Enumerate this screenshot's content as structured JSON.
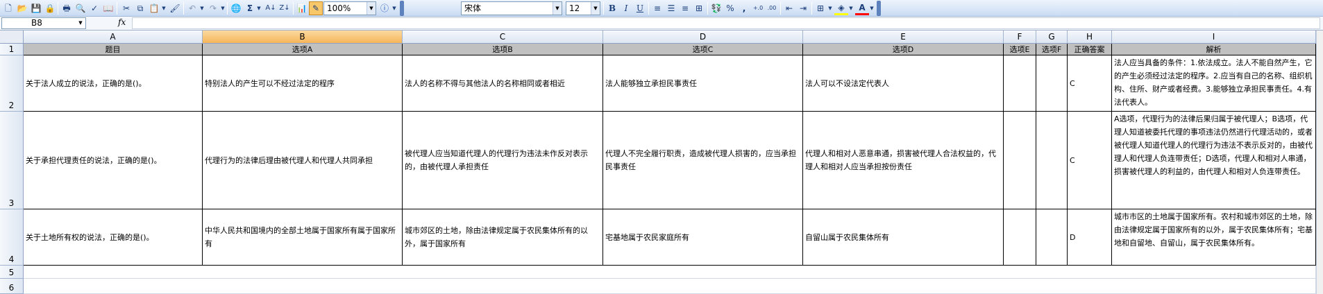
{
  "toolbar": {
    "zoom": "100%",
    "font_name": "宋体",
    "font_size": "12",
    "bold": "B",
    "italic": "I",
    "underline": "U",
    "currency": "%",
    "comma": ",",
    "icons": [
      "new-icon",
      "open-icon",
      "save-icon",
      "permission-icon",
      "email-icon",
      "print-icon",
      "print-preview-icon",
      "spelling-icon",
      "research-icon",
      "cut-icon",
      "copy-icon",
      "paste-icon",
      "format-painter-icon",
      "undo-icon",
      "redo-icon",
      "hyperlink-icon",
      "autosum-icon",
      "sort-ascending-icon",
      "sort-descending-icon",
      "chart-wizard-icon",
      "drawing-icon",
      "help-icon"
    ]
  },
  "formula_bar": {
    "name_box": "B8",
    "fx": "fx",
    "formula": ""
  },
  "columns": [
    "A",
    "B",
    "C",
    "D",
    "E",
    "F",
    "G",
    "H",
    "I"
  ],
  "selected_column": "B",
  "rows": [
    "1",
    "2",
    "3",
    "4",
    "5",
    "6"
  ],
  "header_row": [
    "题目",
    "选项A",
    "选项B",
    "选项C",
    "选项D",
    "选项E",
    "选项F",
    "正确答案",
    "解析"
  ],
  "data_rows": [
    [
      "关于法人成立的说法，正确的是()。",
      "特别法人的产生可以不经过法定的程序",
      "法人的名称不得与其他法人的名称相同或者相近",
      "法人能够独立承担民事责任",
      "法人可以不设法定代表人",
      "",
      "",
      "C",
      "法人应当具备的条件：1.依法成立。法人不能自然产生，它的产生必须经过法定的程序。2.应当有自己的名称、组织机构、住所、财产或者经费。3.能够独立承担民事责任。4.有法代表人。"
    ],
    [
      "关于承担代理责任的说法，正确的是()。",
      "代理行为的法律后理由被代理人和代理人共同承担",
      "被代理人应当知道代理人的代理行为违法未作反对表示的，由被代理人承担责任",
      "代理人不完全履行职责，造成被代理人损害的，应当承担民事责任",
      "代理人和相对人恶意串通，损害被代理人合法权益的，代理人和相对人应当承担按份责任",
      "",
      "",
      "C",
      "A选项，代理行为的法律后果归属于被代理人；B选项，代理人知道被委托代理的事项违法仍然进行代理活动的，或者被代理人知道代理人的代理行为违法不表示反对的，由被代理人和代理人负连带责任；D选项，代理人和相对人串通，损害被代理人的利益的，由代理人和相对人负连带责任。"
    ],
    [
      "关于土地所有权的说法，正确的是()。",
      "中华人民共和国境内的全部土地属于国家所有属于国家所有",
      "城市郊区的土地，除由法律规定属于农民集体所有的以外，属于国家所有",
      "宅基地属于农民家庭所有",
      "自留山属于农民集体所有",
      "",
      "",
      "D",
      "城市市区的土地属于国家所有。农村和城市郊区的土地，除由法律规定属于国家所有的以外，属于农民集体所有；宅基地和自留地、自留山，属于农民集体所有。"
    ]
  ]
}
